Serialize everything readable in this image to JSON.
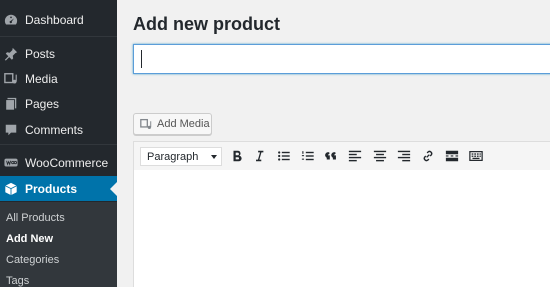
{
  "sidebar": {
    "items": [
      {
        "label": "Dashboard",
        "icon": "dashboard-icon"
      },
      {
        "label": "Posts",
        "icon": "pin-icon"
      },
      {
        "label": "Media",
        "icon": "media-icon"
      },
      {
        "label": "Pages",
        "icon": "pages-icon"
      },
      {
        "label": "Comments",
        "icon": "comments-icon"
      },
      {
        "label": "WooCommerce",
        "icon": "woocommerce-icon"
      },
      {
        "label": "Products",
        "icon": "products-box-icon",
        "current": true
      }
    ],
    "submenu": [
      {
        "label": "All Products"
      },
      {
        "label": "Add New",
        "current": true
      },
      {
        "label": "Categories"
      },
      {
        "label": "Tags"
      }
    ]
  },
  "main": {
    "title": "Add new product",
    "title_input_value": ""
  },
  "editor": {
    "add_media_label": "Add Media",
    "format_select": "Paragraph",
    "toolbar_icons": [
      "bold-icon",
      "italic-icon",
      "bullet-list-icon",
      "numbered-list-icon",
      "blockquote-icon",
      "align-left-icon",
      "align-center-icon",
      "align-right-icon",
      "link-icon",
      "read-more-icon",
      "toolbar-toggle-icon"
    ]
  },
  "colors": {
    "sidebar_bg": "#23282d",
    "submenu_bg": "#32373c",
    "accent": "#0073aa",
    "page_bg": "#f1f1f1"
  }
}
